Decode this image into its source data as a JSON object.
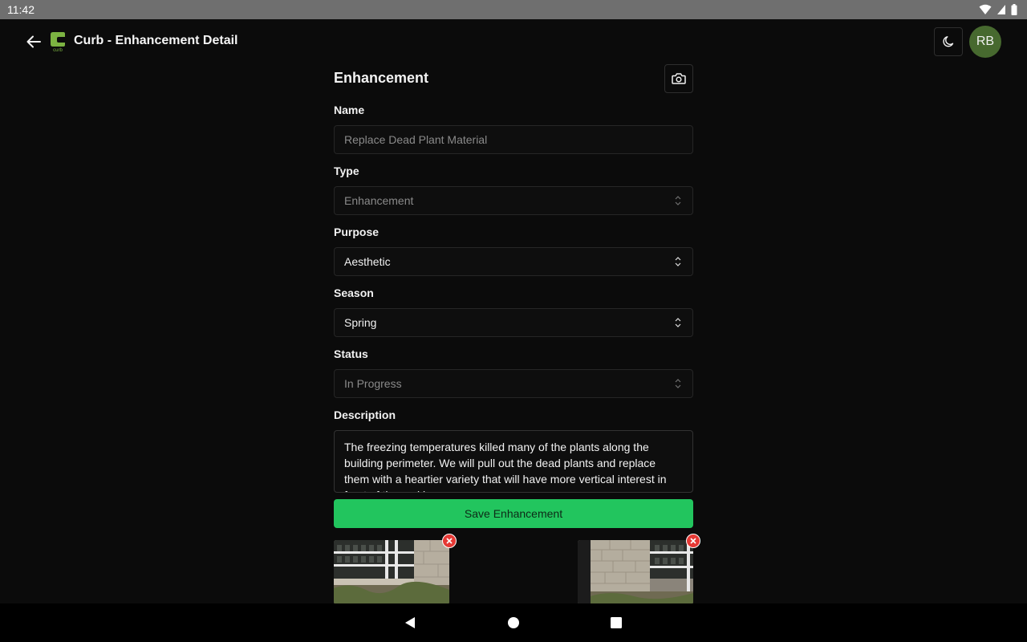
{
  "status_bar": {
    "time": "11:42"
  },
  "app_bar": {
    "title": "Curb - Enhancement Detail",
    "logo_text": "curb",
    "avatar_initials": "RB"
  },
  "form": {
    "heading": "Enhancement",
    "name": {
      "label": "Name",
      "placeholder": "Replace Dead Plant Material"
    },
    "type": {
      "label": "Type",
      "value": "Enhancement"
    },
    "purpose": {
      "label": "Purpose",
      "value": "Aesthetic"
    },
    "season": {
      "label": "Season",
      "value": "Spring"
    },
    "status": {
      "label": "Status",
      "value": "In Progress"
    },
    "description": {
      "label": "Description",
      "value": "The freezing temperatures killed many of the plants along the building perimeter.  We will pull out the dead plants and replace them with a heartier variety that will have more vertical interest in front of the parking garage."
    },
    "save_label": "Save Enhancement"
  },
  "colors": {
    "accent": "#22c55e",
    "avatar": "#47692f",
    "delete": "#e53935"
  }
}
